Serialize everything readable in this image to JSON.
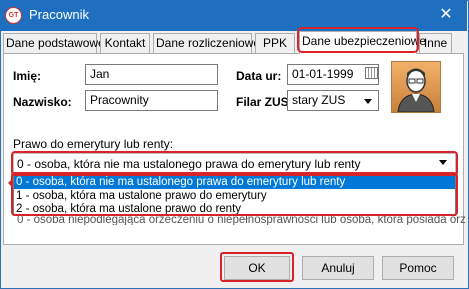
{
  "window": {
    "title": "Pracownik",
    "close_glyph": "✕",
    "app_icon_text": "GT"
  },
  "tabs": [
    {
      "label": "Dane podstawowe"
    },
    {
      "label": "Kontakt"
    },
    {
      "label": "Dane rozliczeniowe"
    },
    {
      "label": "PPK"
    },
    {
      "label": "Dane ubezpieczeniowe",
      "active": true
    },
    {
      "label": "Inne"
    }
  ],
  "form": {
    "imie_label": "Imię:",
    "imie_value": "Jan",
    "nazwisko_label": "Nazwisko:",
    "nazwisko_value": "Pracownity",
    "data_ur_label": "Data ur:",
    "data_ur_value": "01-01-1999",
    "filar_label": "Filar ZUS:",
    "filar_value": "stary ZUS"
  },
  "pension": {
    "label": "Prawo do emerytury lub renty:",
    "selected": "0 - osoba, która nie ma ustalonego prawa do emerytury lub renty",
    "options": [
      "0 - osoba, która nie ma ustalonego prawa do emerytury lub renty",
      "1 - osoba, która ma ustalone prawo do emerytury",
      "2 - osoba, która ma ustalone prawo do renty"
    ],
    "partially_hidden_text": "0 - osoba niepodlegająca orzeczeniu o niepełnosprawności lub osoba, która posiada orz"
  },
  "buttons": {
    "ok": "OK",
    "cancel": "Anuluj",
    "help": "Pomoc"
  },
  "colors": {
    "titlebar": "#1f6fc0",
    "highlight": "#d8232a",
    "selection": "#0078d7"
  }
}
